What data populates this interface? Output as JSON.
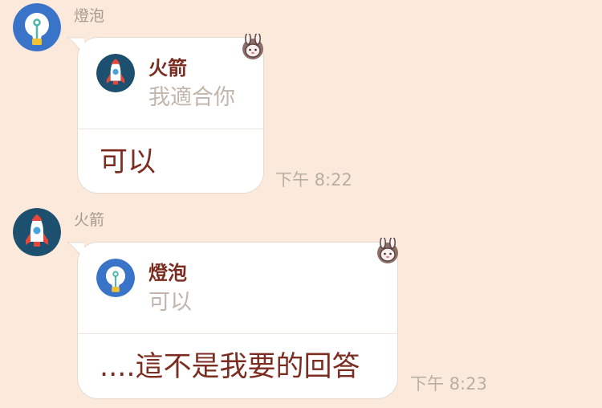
{
  "messages": [
    {
      "sender": "燈泡",
      "avatar_icon": "lightbulb-icon",
      "quote": {
        "name": "火箭",
        "avatar_icon": "rocket-icon",
        "text": "我適合你"
      },
      "text": "可以",
      "time": "下午 8:22",
      "reaction_icon": "bunny-sticker-icon"
    },
    {
      "sender": "火箭",
      "avatar_icon": "rocket-icon",
      "quote": {
        "name": "燈泡",
        "avatar_icon": "lightbulb-icon",
        "text": "可以"
      },
      "text": "....這不是我要的回答",
      "time": "下午 8:23",
      "reaction_icon": "bunny-sticker-icon"
    }
  ],
  "colors": {
    "background": "#fbeadb",
    "name_gray": "#a59b92",
    "accent_red": "#7b2d22",
    "quote_gray": "#c2b6ac",
    "lightbulb_blue": "#3a74c9",
    "rocket_navy": "#1d4f6e"
  }
}
